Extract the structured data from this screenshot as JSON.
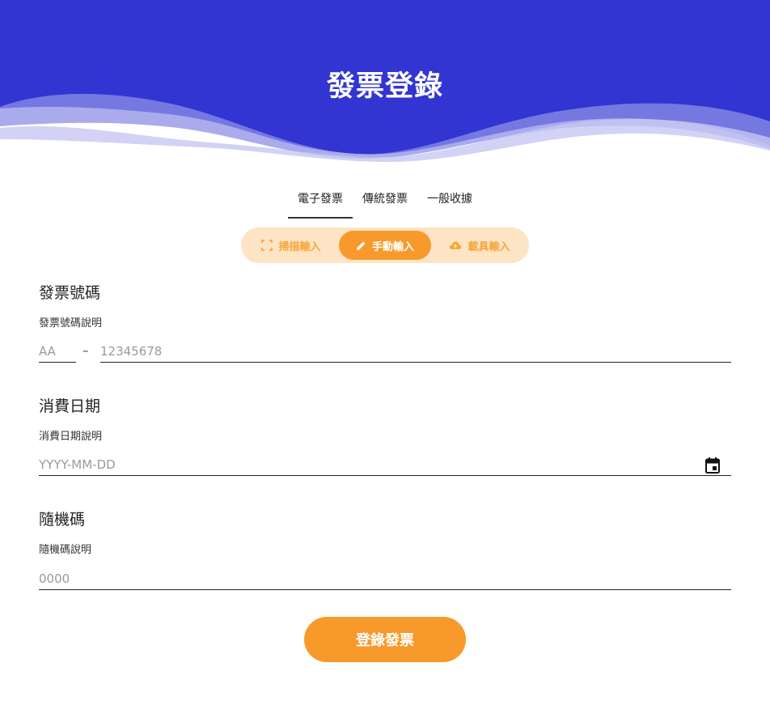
{
  "header": {
    "title": "發票登錄"
  },
  "tabs": [
    {
      "label": "電子發票",
      "active": true
    },
    {
      "label": "傳統發票",
      "active": false
    },
    {
      "label": "一般收據",
      "active": false
    }
  ],
  "modes": [
    {
      "label": "掃描輸入",
      "icon": "scan-icon",
      "active": false
    },
    {
      "label": "手動輸入",
      "icon": "pencil-icon",
      "active": true
    },
    {
      "label": "載具輸入",
      "icon": "cloud-upload-icon",
      "active": false
    }
  ],
  "fields": {
    "invoice": {
      "title": "發票號碼",
      "description": "發票號碼說明",
      "prefix_placeholder": "AA",
      "separator": "–",
      "number_placeholder": "12345678"
    },
    "date": {
      "title": "消費日期",
      "description": "消費日期說明",
      "placeholder": "YYYY-MM-DD"
    },
    "random": {
      "title": "隨機碼",
      "description": "隨機碼說明",
      "placeholder": "0000"
    }
  },
  "submit": {
    "label": "登錄發票"
  },
  "colors": {
    "header": "#3235d1",
    "accent": "#f8992b",
    "accent_light": "#fde4c4"
  }
}
